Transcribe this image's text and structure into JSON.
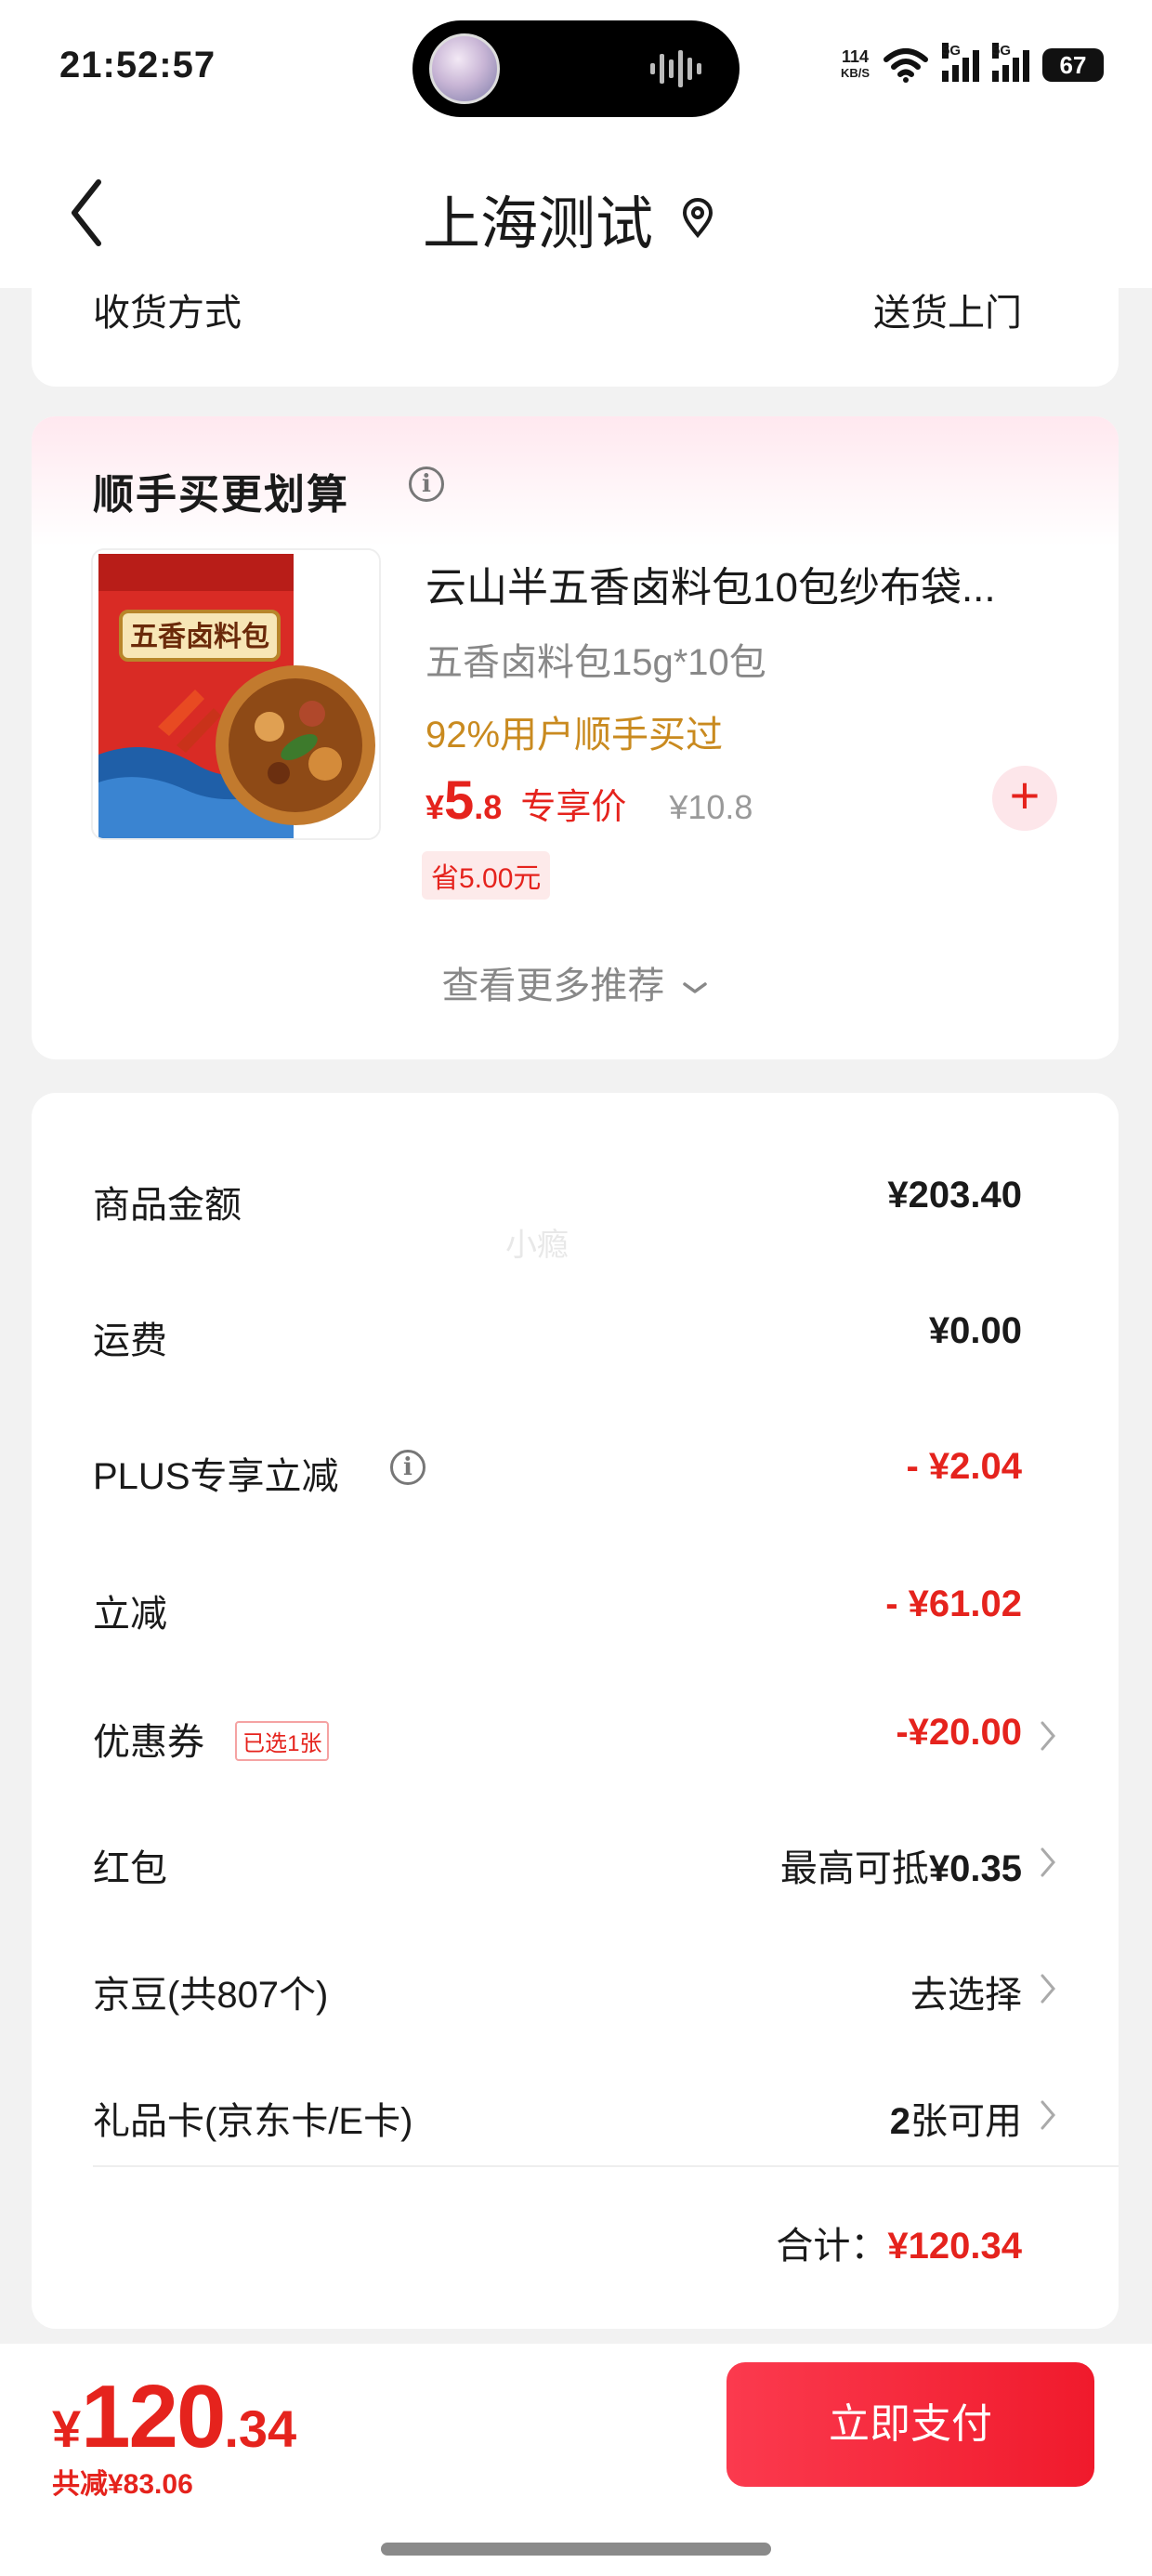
{
  "status_bar": {
    "time": "21:52:57",
    "net_speed_value": "114",
    "net_speed_unit": "KB/S",
    "signal_1_label": "5G",
    "signal_2_label": "5G",
    "battery": "67"
  },
  "header": {
    "title": "上海测试"
  },
  "delivery": {
    "label": "收货方式",
    "value": "送货上门"
  },
  "recommend": {
    "title": "顺手买更划算",
    "product": {
      "name": "云山半五香卤料包10包纱布袋...",
      "spec": "五香卤料包15g*10包",
      "buy_rate": "92%用户顺手买过",
      "price_symbol": "¥",
      "price_int": "5",
      "price_dec": ".8",
      "price_tag": "专享价",
      "original_price": "¥10.8",
      "saved": "省5.00元",
      "image_text": "五香卤料包"
    },
    "see_more": "查看更多推荐"
  },
  "summary": {
    "watermark": "小瘾",
    "rows": [
      {
        "label": "商品金额",
        "value": "¥203.40"
      },
      {
        "label": "运费",
        "value": "¥0.00"
      },
      {
        "label": "PLUS专享立减",
        "value": "- ¥2.04"
      },
      {
        "label": "立减",
        "value": "- ¥61.02"
      },
      {
        "label": "优惠券",
        "tag": "已选1张",
        "value": "-¥20.00"
      },
      {
        "label": "红包",
        "value_prefix": "最高可抵",
        "value": "¥0.35"
      },
      {
        "label": "京豆(共807个)",
        "value": "去选择"
      },
      {
        "label": "礼品卡(京东卡/E卡)",
        "value_num": "2",
        "value": "张可用"
      }
    ],
    "total_label": "合计：",
    "total_value": "¥120.34"
  },
  "bottom": {
    "price_symbol": "¥",
    "price_int": "120",
    "price_dec": ".34",
    "saved": "共减¥83.06",
    "pay_label": "立即支付"
  },
  "colors": {
    "accent_red": "#e5231d",
    "gold": "#c98a1f"
  }
}
